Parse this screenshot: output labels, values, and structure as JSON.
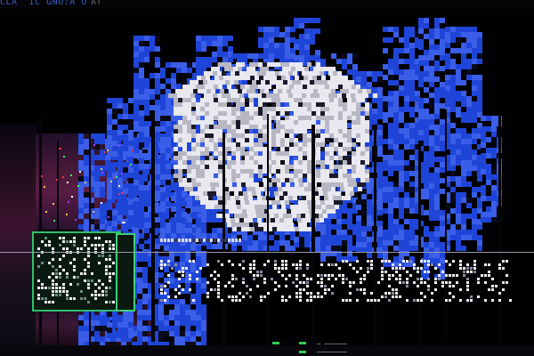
{
  "header": {
    "text_left": "CLA  IC GNO:A O",
    "text_right": "AT"
  },
  "footer": {
    "readout_line_1": "‒ ‒‒‒‒‒‒",
    "readout_line_2": "‒‒‒‒‒‒‒‒"
  },
  "colors": {
    "background": "#010103",
    "glitch_blue": "#1f45d8",
    "glitch_blue_light": "#3a5ee8",
    "glitch_white": "#e8e8ee",
    "glitch_gray": "#b8b8c4",
    "accent_green": "#2fbf6a",
    "band_purple": "#4a1a3a"
  }
}
